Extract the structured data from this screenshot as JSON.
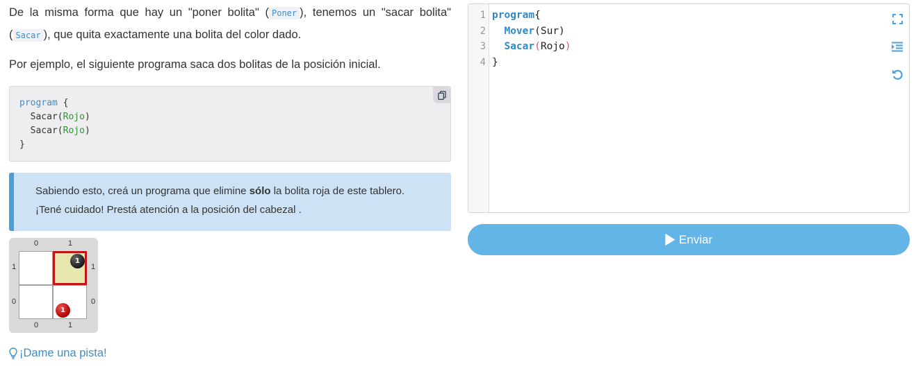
{
  "intro": {
    "p1_a": "De la misma forma que hay un \"poner bolita\" (",
    "p1_poner": "Poner",
    "p1_b": "), tenemos un \"sacar bolita\" (",
    "p1_sacar": "Sacar",
    "p1_c": "), que quita exactamente una bolita del color dado.",
    "p2": "Por ejemplo, el siguiente programa saca dos bolitas de la posición inicial."
  },
  "example_code": {
    "line1_kw": "program",
    "line1_rest": " {",
    "line2_fn": "  Sacar(",
    "line2_arg": "Rojo",
    "line2_end": ")",
    "line3_fn": "  Sacar(",
    "line3_arg": "Rojo",
    "line3_end": ")",
    "line4": "}",
    "copy_icon": "copy-icon"
  },
  "task": {
    "before": "Sabiendo esto, creá un programa que elimine ",
    "bold": "sólo",
    "after": " la bolita roja de este tablero. ¡Tené cuidado! Prestá atención a la posición del cabezal ."
  },
  "board": {
    "col_labels": [
      "0",
      "1"
    ],
    "row_labels": [
      "1",
      "0"
    ],
    "head_cell": "1,1",
    "balls": [
      {
        "cell": "1,1",
        "color": "#1a1a1a",
        "count": "1"
      },
      {
        "cell": "1,0",
        "color": "#c00000",
        "count": "1"
      }
    ]
  },
  "hint": {
    "label": "¡Dame una pista!",
    "icon": "lightbulb-icon"
  },
  "editor": {
    "line_numbers": [
      "1",
      "2",
      "3",
      "4"
    ],
    "l1_kw": "program",
    "l1_rest": "{",
    "l2_indent": "  ",
    "l2_fn": "Mover",
    "l2_rest": "(Sur)",
    "l3_indent": "  ",
    "l3_fn": "Sacar",
    "l3_open": "(",
    "l3_arg": "Rojo",
    "l3_close": ")",
    "l4": "}",
    "tools": [
      "fullscreen-icon",
      "indent-icon",
      "reset-icon"
    ]
  },
  "submit": {
    "label": "Enviar",
    "icon": "play-icon",
    "color": "#63b5e8"
  }
}
